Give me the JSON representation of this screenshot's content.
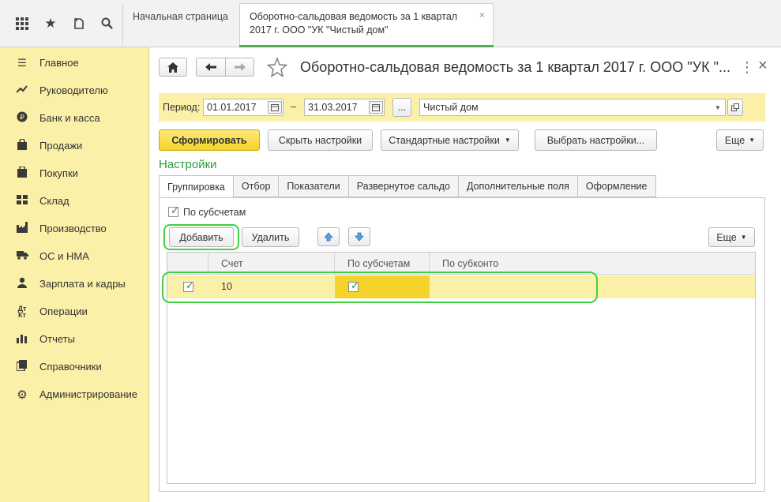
{
  "topbar": {
    "icons": [
      "grid-icon",
      "star-icon",
      "history-icon",
      "search-icon"
    ],
    "tabs": [
      {
        "label": "Начальная страница"
      },
      {
        "label_line1": "Оборотно-сальдовая ведомость за 1 квартал",
        "label_line2": "2017 г. ООО \"УК \"Чистый дом\"",
        "close": "×"
      }
    ]
  },
  "sidebar": {
    "items": [
      {
        "label": "Главное",
        "icon": "menu-icon"
      },
      {
        "label": "Руководителю",
        "icon": "trend-icon"
      },
      {
        "label": "Банк и касса",
        "icon": "ruble-icon"
      },
      {
        "label": "Продажи",
        "icon": "bag-icon"
      },
      {
        "label": "Покупки",
        "icon": "cart-icon"
      },
      {
        "label": "Склад",
        "icon": "warehouse-icon"
      },
      {
        "label": "Производство",
        "icon": "factory-icon"
      },
      {
        "label": "ОС и НМА",
        "icon": "truck-icon"
      },
      {
        "label": "Зарплата и кадры",
        "icon": "people-icon"
      },
      {
        "label": "Операции",
        "icon": "dt-kt-icon"
      },
      {
        "label": "Отчеты",
        "icon": "bar-chart-icon"
      },
      {
        "label": "Справочники",
        "icon": "book-icon"
      },
      {
        "label": "Администрирование",
        "icon": "gear-icon"
      }
    ]
  },
  "header": {
    "title": "Оборотно-сальдовая ведомость за 1 квартал 2017 г. ООО \"УК \"...",
    "more": "⋮",
    "close": "×"
  },
  "period": {
    "label": "Период:",
    "from": "01.01.2017",
    "dash": "–",
    "to": "31.03.2017",
    "dots": "...",
    "org": "Чистый дом"
  },
  "toolbar": {
    "generate": "Сформировать",
    "hide_settings": "Скрыть настройки",
    "standard_settings": "Стандартные настройки",
    "choose_settings": "Выбрать настройки...",
    "more": "Еще"
  },
  "settings": {
    "title": "Настройки",
    "tabs": [
      "Группировка",
      "Отбор",
      "Показатели",
      "Развернутое сальдо",
      "Дополнительные поля",
      "Оформление"
    ],
    "by_subaccounts_label": "По субсчетам",
    "add": "Добавить",
    "delete": "Удалить",
    "more": "Еще",
    "columns": [
      "Счет",
      "По субсчетам",
      "По субконто"
    ],
    "rows": [
      {
        "account": "10"
      }
    ]
  }
}
